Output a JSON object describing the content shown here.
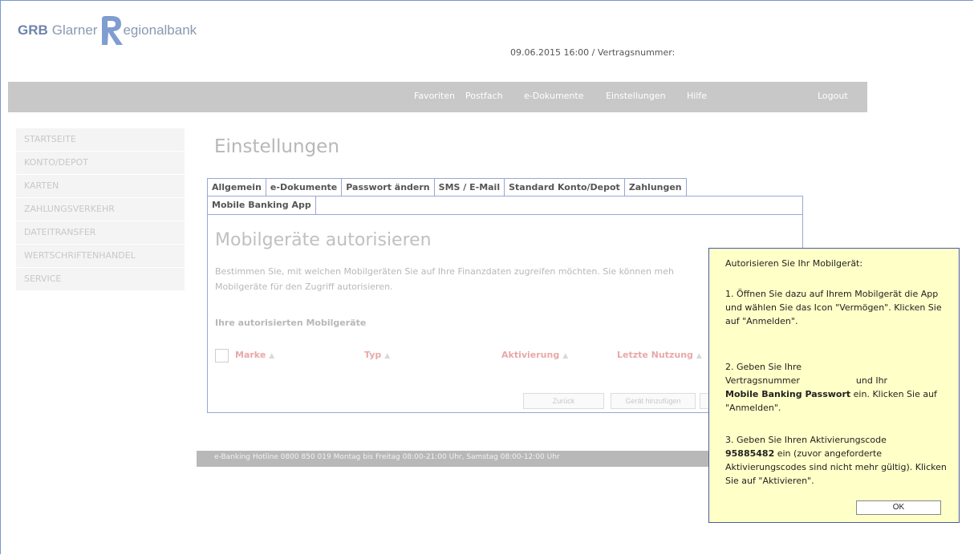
{
  "logo": {
    "grb": "GRB",
    "glarner": "Glarner",
    "regional": "egionalbank"
  },
  "header": {
    "date_contract": "09.06.2015 16:00 / Vertragsnummer:"
  },
  "nav": {
    "items": [
      "Favoriten",
      "Postfach",
      "e-Dokumente",
      "Einstellungen",
      "Hilfe"
    ],
    "logout": "Logout"
  },
  "sidebar": {
    "items": [
      "STARTSEITE",
      "KONTO/DEPOT",
      "KARTEN",
      "ZAHLUNGSVERKEHR",
      "DATEITRANSFER",
      "WERTSCHRIFTENHANDEL",
      "SERVICE"
    ]
  },
  "main": {
    "title": "Einstellungen",
    "tabs": [
      "Allgemein",
      "e-Dokumente",
      "Passwort ändern",
      "SMS / E-Mail",
      "Standard Konto/Depot",
      "Zahlungen"
    ],
    "subtab": "Mobile Banking App",
    "section_title": "Mobilgeräte autorisieren",
    "description_line1": "Bestimmen Sie, mit welchen Mobilgeräten Sie auf Ihre Finanzdaten zugreifen möchten. Sie können meh",
    "description_line2": "Mobilgeräte für den Zugriff autorisieren.",
    "subheading": "Ihre autorisierten Mobilgeräte",
    "columns": [
      "Marke",
      "Typ",
      "Aktivierung",
      "Letzte Nutzung"
    ],
    "buttons": {
      "back": "Zurück",
      "add_device": "Gerät hinzufügen"
    }
  },
  "footer": {
    "hotline": "e-Banking Hotline 0800 850 019 Montag bis Freitag 08:00-21:00 Uhr, Samstag 08:00-12:00 Uhr"
  },
  "popup": {
    "title": "Autorisieren Sie Ihr Mobilgerät:",
    "step1": "1. Öffnen Sie dazu auf Ihrem Mobilgerät die App und wählen Sie das Icon \"Vermögen\". Klicken Sie auf \"Anmelden\".",
    "step2_a": "2. Geben Sie Ihre",
    "step2_b": "Vertragsnummer",
    "step2_c": "und Ihr",
    "step2_bold": "Mobile Banking Passwort",
    "step2_d": "ein. Klicken Sie auf \"Anmelden\".",
    "step3_a": "3. Geben Sie Ihren Aktivierungscode",
    "step3_code": "95885482",
    "step3_b": "ein (zuvor angeforderte Aktivierungscodes sind nicht mehr gültig). Klicken Sie auf \"Aktivieren\".",
    "ok": "OK"
  },
  "colors": {
    "nav_bg": "#c8c8c8",
    "popup_bg": "#ffffc8",
    "popup_border": "#4a5aa8",
    "tab_border": "#9aa6d6",
    "column_header": "#e8a8a8"
  }
}
